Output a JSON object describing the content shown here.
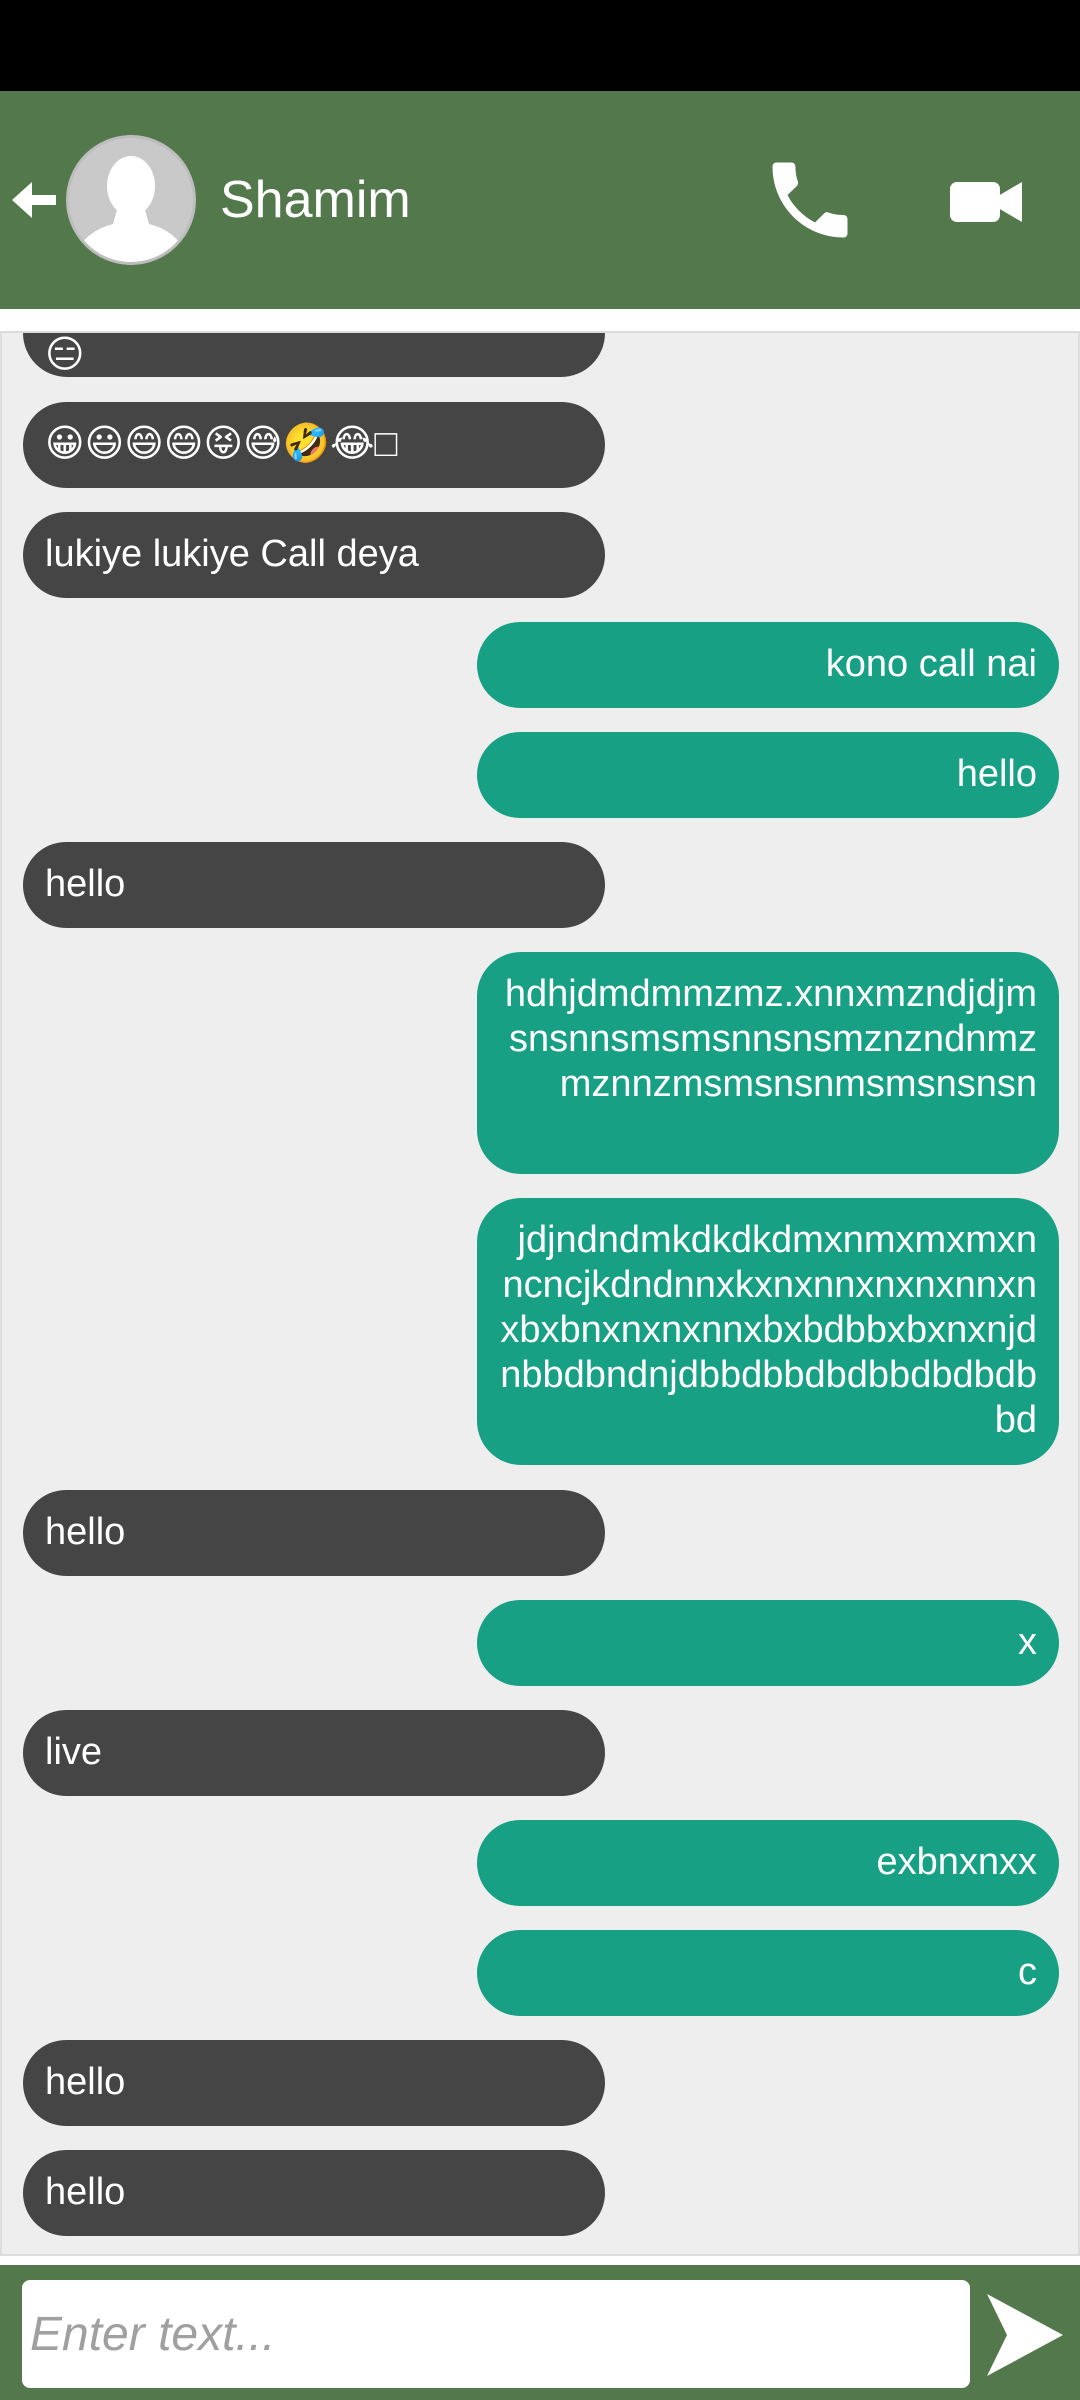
{
  "header": {
    "contact_name": "Shamim",
    "icons": {
      "back": "back-arrow-icon",
      "avatar": "person-silhouette-icon",
      "call": "phone-icon",
      "video": "video-camera-icon"
    }
  },
  "messages": [
    {
      "direction": "received",
      "text": "😑"
    },
    {
      "direction": "received",
      "text": "😀😃😄😄😝😅🤣😂□"
    },
    {
      "direction": "received",
      "text": "lukiye lukiye Call deya"
    },
    {
      "direction": "sent",
      "text": "kono call nai"
    },
    {
      "direction": "sent",
      "text": "hello"
    },
    {
      "direction": "received",
      "text": "hello"
    },
    {
      "direction": "sent",
      "text": "hdhjdmdmmzmz.xnnxmzndjdjmsnsnnsmsmsnnsnsmznzndnmzmznnzmsmsnsnmsmsnsnsn"
    },
    {
      "direction": "sent",
      "text": "jdjndndmkdkdkdmxnmxmxmxnncncjkdndnnxkxnxnnxnxnxnnxnxbxbnxnxnxnnxbxbdbbxbxnxnjdnbbdbndnjdbbdbbdbdbbdbdbdbbd"
    },
    {
      "direction": "received",
      "text": "hello"
    },
    {
      "direction": "sent",
      "text": "x"
    },
    {
      "direction": "received",
      "text": "live"
    },
    {
      "direction": "sent",
      "text": "exbnxnxx"
    },
    {
      "direction": "sent",
      "text": "c"
    },
    {
      "direction": "received",
      "text": "hello"
    },
    {
      "direction": "received",
      "text": "hello"
    }
  ],
  "composer": {
    "placeholder": "Enter text...",
    "value": "",
    "send_icon": "send-arrow-icon"
  },
  "colors": {
    "app_bar": "#52784b",
    "sent_bubble": "#18a085",
    "received_bubble": "#454545",
    "chat_background": "#eeeeee"
  }
}
